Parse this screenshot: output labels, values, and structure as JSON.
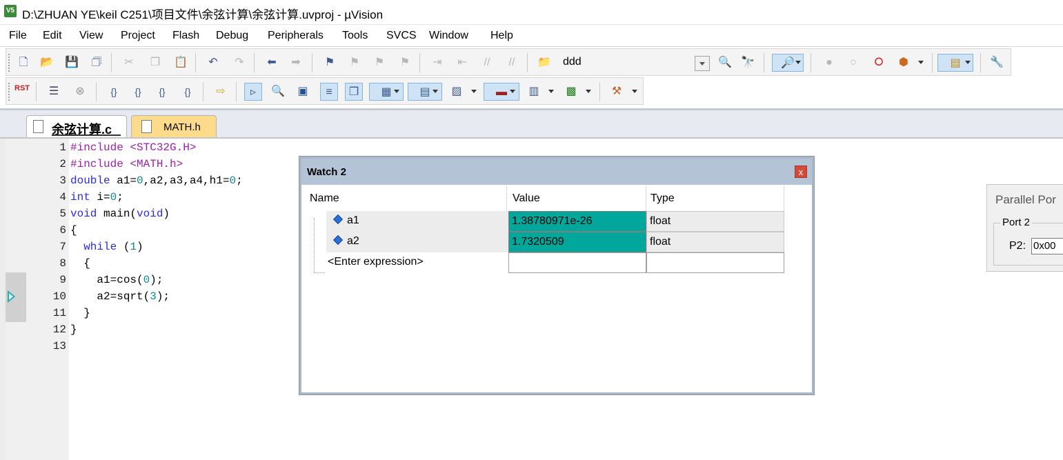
{
  "window": {
    "title": "D:\\ZHUAN YE\\keil C251\\项目文件\\余弦计算\\余弦计算.uvproj - µVision",
    "app_icon_label": "V5"
  },
  "menu": [
    "File",
    "Edit",
    "View",
    "Project",
    "Flash",
    "Debug",
    "Peripherals",
    "Tools",
    "SVCS",
    "Window",
    "Help"
  ],
  "toolbar": {
    "find_text": "ddd",
    "rst_label": "RST"
  },
  "tabs": [
    {
      "label": "余弦计算.c",
      "active": true
    },
    {
      "label": "MATH.h",
      "active": false
    }
  ],
  "editor": {
    "line_numbers": [
      "1",
      "2",
      "3",
      "4",
      "5",
      "6",
      "7",
      "8",
      "9",
      "10",
      "11",
      "12",
      "13"
    ],
    "current_line": 10
  },
  "watch": {
    "title": "Watch 2",
    "close_label": "x",
    "columns": [
      "Name",
      "Value",
      "Type"
    ],
    "rows": [
      {
        "name": "a1",
        "value": "1.38780971e-26",
        "type": "float"
      },
      {
        "name": "a2",
        "value": "1.7320509",
        "type": "float"
      }
    ],
    "enter_expression": "<Enter expression>"
  },
  "parallel_port": {
    "title": "Parallel Por",
    "group_label": "Port 2",
    "p2_label": "P2:",
    "p2_value": "0x00"
  },
  "colors": {
    "value_highlight": "#00a79a",
    "watch_title_bg": "#b4c3d6",
    "keyword": "#2c2ce0",
    "preprocessor": "#9b1fa8",
    "number": "#0a8a8a",
    "pc_arrow": "#20b0b8",
    "math_tab": "#fcdc8a"
  }
}
